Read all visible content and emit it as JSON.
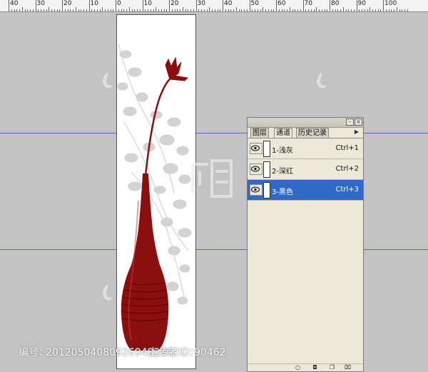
{
  "ruler": {
    "labels": [
      "40",
      "30",
      "20",
      "10",
      "0",
      "10",
      "20",
      "30",
      "40",
      "50",
      "60",
      "70",
      "80",
      "90",
      "100"
    ]
  },
  "panel": {
    "tabs": [
      "图层",
      "通道",
      "历史记录"
    ],
    "active_tab": "通道",
    "channels": [
      {
        "label": "1-浅灰",
        "shortcut": "Ctrl+1",
        "selected": false
      },
      {
        "label": "2-深红",
        "shortcut": "Ctrl+2",
        "selected": false
      },
      {
        "label": "3-黑色",
        "shortcut": "Ctrl+3",
        "selected": true
      }
    ]
  },
  "caption": {
    "id_label": "编号：",
    "id_value": "20120504080926948200",
    "uploader_label": "上传者ID：",
    "uploader_value": "90462"
  },
  "colors": {
    "vase": "#8b0f0f",
    "leaves": "#d3d3d3",
    "selection": "#3169c6",
    "guide": "#5a6bc4"
  }
}
